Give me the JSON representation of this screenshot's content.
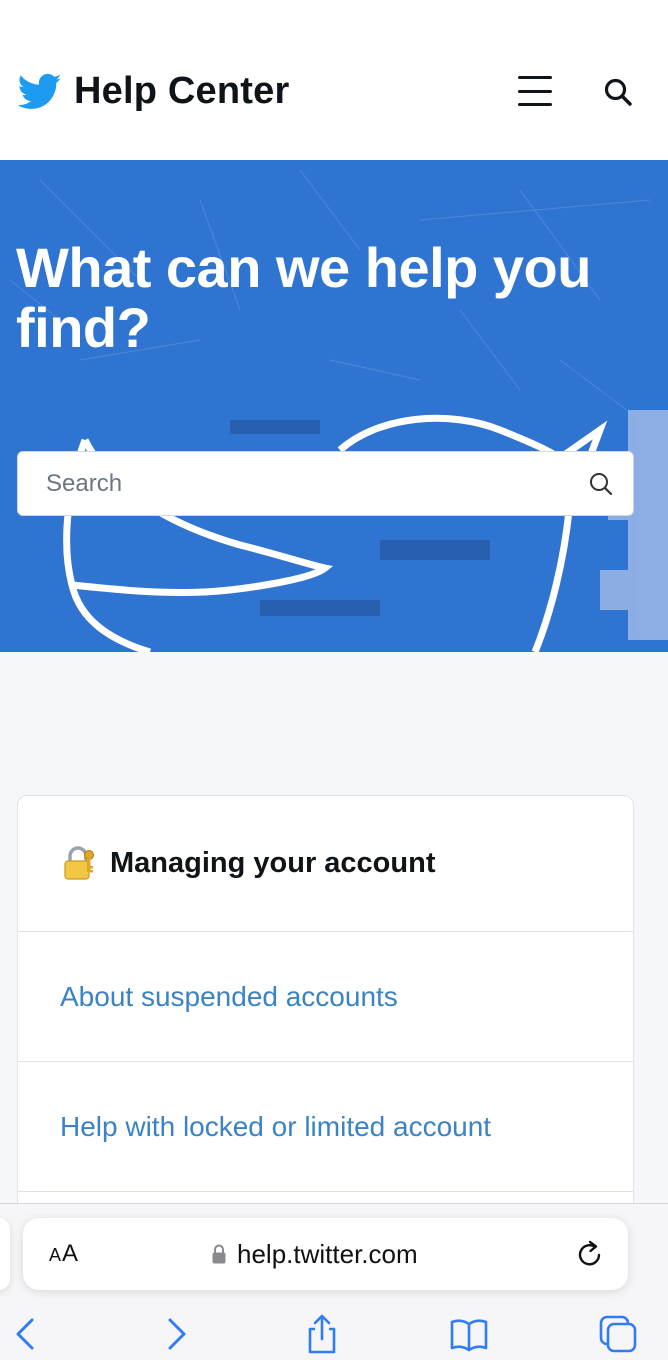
{
  "header": {
    "brand_title": "Help Center",
    "menu_icon": "hamburger-menu-icon",
    "search_icon": "search-icon",
    "logo_icon": "twitter-bird-icon"
  },
  "hero": {
    "title": "What can we help you find?",
    "search_placeholder": "Search",
    "search_icon": "search-icon"
  },
  "section": {
    "icon": "locked-with-key-icon",
    "title": "Managing your account",
    "links": [
      "About suspended accounts",
      "Help with locked or limited account"
    ]
  },
  "browser": {
    "text_size_label_small": "A",
    "text_size_label_large": "A",
    "url": "help.twitter.com",
    "lock_icon": "padlock-icon",
    "reload_icon": "reload-icon",
    "toolbar": [
      "back-icon",
      "forward-icon",
      "share-icon",
      "bookmarks-icon",
      "tabs-icon"
    ]
  },
  "colors": {
    "brand_blue": "#1d9bf0",
    "hero_blue": "#2f74d0",
    "link_blue": "#3a83c5",
    "ios_blue": "#2f7cf6"
  }
}
